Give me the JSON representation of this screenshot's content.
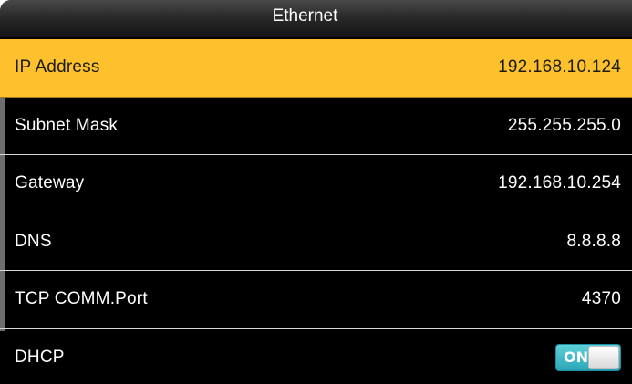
{
  "window": {
    "title": "Ethernet"
  },
  "settings": [
    {
      "label": "IP Address",
      "value": "192.168.10.124",
      "selected": true
    },
    {
      "label": "Subnet Mask",
      "value": "255.255.255.0"
    },
    {
      "label": "Gateway",
      "value": "192.168.10.254"
    },
    {
      "label": "DNS",
      "value": "8.8.8.8"
    },
    {
      "label": "TCP COMM.Port",
      "value": "4370"
    },
    {
      "label": "DHCP",
      "toggle": {
        "state_label": "ON",
        "on": true
      }
    }
  ],
  "colors": {
    "selected_row": "#fcc12c",
    "background": "#000000",
    "toggle_on": "#2ba6b8"
  }
}
